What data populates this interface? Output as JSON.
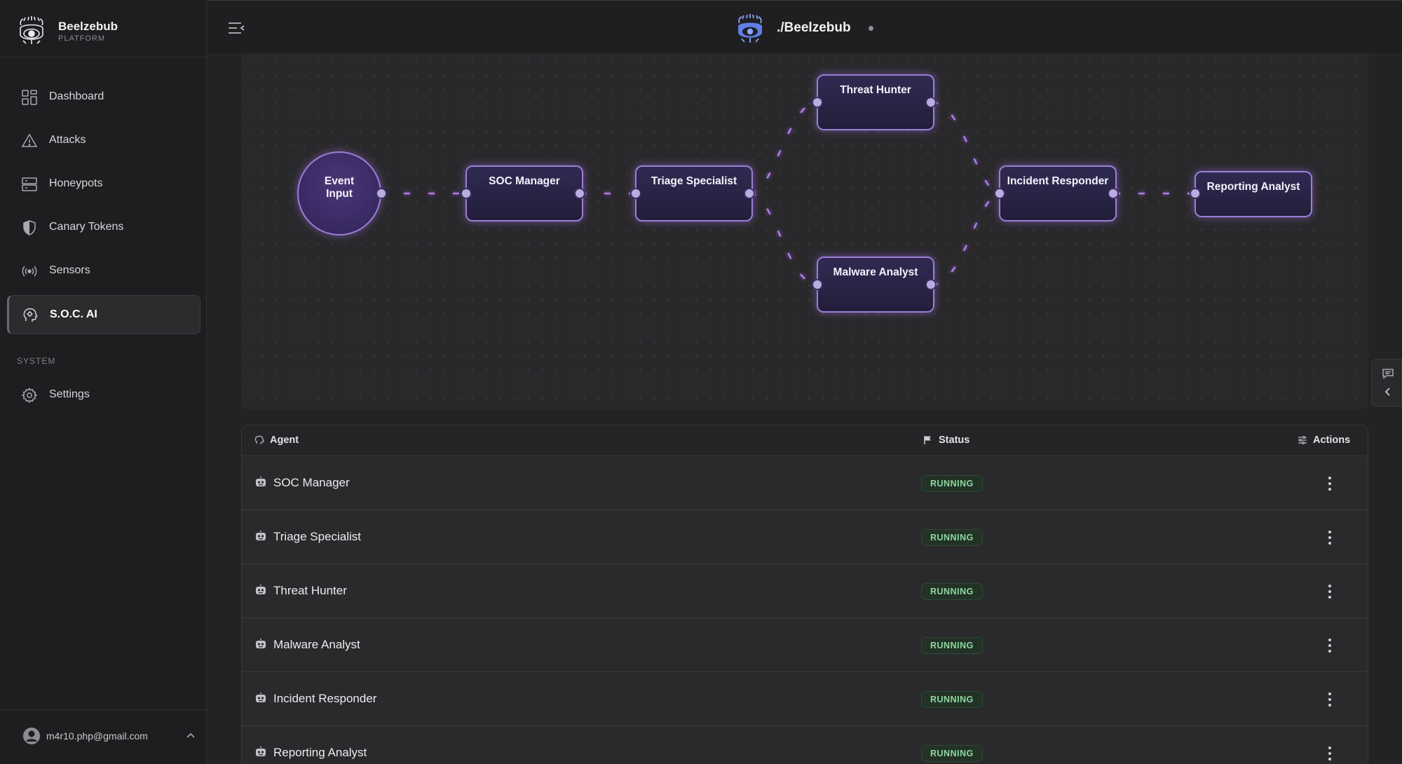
{
  "brand": {
    "title": "Beelzebub",
    "subtitle": "PLATFORM"
  },
  "header": {
    "title": "./Beelzebub"
  },
  "sidebar": {
    "items": [
      {
        "label": "Dashboard",
        "icon": "dashboard-grid-icon"
      },
      {
        "label": "Attacks",
        "icon": "warning-triangle-icon"
      },
      {
        "label": "Honeypots",
        "icon": "server-icon"
      },
      {
        "label": "Canary Tokens",
        "icon": "shield-icon"
      },
      {
        "label": "Sensors",
        "icon": "broadcast-icon"
      },
      {
        "label": "S.O.C. AI",
        "icon": "ai-head-icon",
        "active": true
      }
    ],
    "section_system": "SYSTEM",
    "system_items": [
      {
        "label": "Settings",
        "icon": "gear-icon"
      }
    ]
  },
  "user": {
    "email": "m4r10.php@gmail.com"
  },
  "flow": {
    "nodes": {
      "event_input": "Event Input",
      "soc_manager": "SOC Manager",
      "triage_specialist": "Triage Specialist",
      "threat_hunter": "Threat Hunter",
      "malware_analyst": "Malware Analyst",
      "incident_responder": "Incident Responder",
      "reporting_analyst": "Reporting Analyst"
    }
  },
  "table": {
    "columns": {
      "agent": "Agent",
      "status": "Status",
      "actions": "Actions"
    },
    "rows": [
      {
        "name": "SOC Manager",
        "status": "RUNNING"
      },
      {
        "name": "Triage Specialist",
        "status": "RUNNING"
      },
      {
        "name": "Threat Hunter",
        "status": "RUNNING"
      },
      {
        "name": "Malware Analyst",
        "status": "RUNNING"
      },
      {
        "name": "Incident Responder",
        "status": "RUNNING"
      },
      {
        "name": "Reporting Analyst",
        "status": "RUNNING"
      }
    ]
  },
  "colors": {
    "accent": "#9a7fd6",
    "running": "#8fd79e",
    "background": "#232325"
  }
}
